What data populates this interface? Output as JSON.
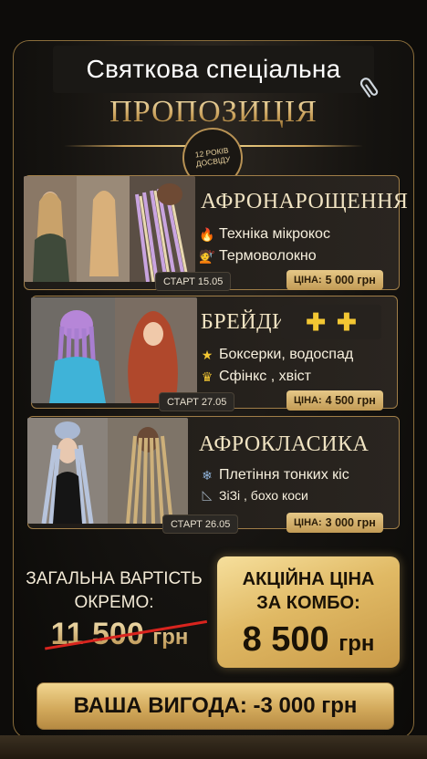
{
  "header": {
    "title": "Святкова спеціальна",
    "subtitle": "ПРОПОЗИЦІЯ",
    "badge_lines": [
      "12 РОКІВ",
      "ДОСВІДУ"
    ]
  },
  "services": [
    {
      "title": "АФРОНАРОЩЕННЯ",
      "features": [
        {
          "icon": "fire-icon",
          "text": "Техніка мікрокос"
        },
        {
          "icon": "hairdresser-icon",
          "text": "Термоволокно"
        }
      ],
      "start": "СТАРТ 15.05",
      "price_label": "ЦІНА:",
      "price_value": "5 000 грн"
    },
    {
      "title": "БРЕЙДИ",
      "title_decor": [
        "✚",
        "✚"
      ],
      "features": [
        {
          "icon": "star-icon",
          "text": "Боксерки, водоспад"
        },
        {
          "icon": "crown-icon",
          "text": "Сфінкс  , хвіст"
        }
      ],
      "start": "СТАРТ 27.05",
      "price_label": "ЦІНА:",
      "price_value": "4 500 грн"
    },
    {
      "title": "АФРОКЛАСИКА",
      "features": [
        {
          "icon": "snowflake-icon",
          "text": "Плетіння тонких кіс"
        },
        {
          "icon": "ruler-triangle-icon",
          "text": "ЗіЗі , бохо коси"
        }
      ],
      "start": "СТАРТ 26.05",
      "price_label": "ЦІНА:",
      "price_value": "3 000 грн"
    }
  ],
  "totals": {
    "separate_label_1": "ЗАГАЛЬНА ВАРТІСТЬ",
    "separate_label_2": "ОКРЕМО:",
    "old_price": "11 500",
    "old_currency": "грн",
    "combo_label_1": "АКЦІЙНА ЦІНА",
    "combo_label_2": "ЗА КОМБО:",
    "combo_price": "8 500",
    "combo_currency": "грн",
    "savings": "ВАША ВИГОДА: -3 000 грн"
  },
  "colors": {
    "gold": "#c9a05a",
    "gold_light": "#f3d98e",
    "strike_red": "#d8241e",
    "background": "#0d0c0a"
  }
}
